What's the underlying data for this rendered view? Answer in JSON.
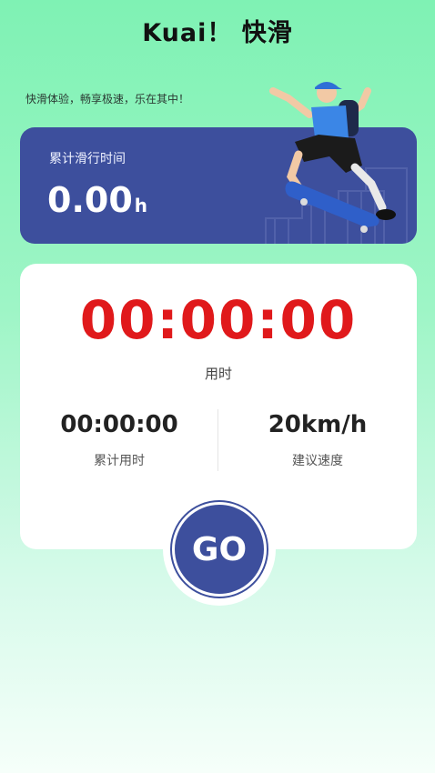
{
  "app": {
    "title": "Kuai！ 快滑",
    "tagline": "快滑体验，畅享极速，乐在其中！"
  },
  "summary": {
    "label": "累计滑行时间",
    "value": "0.00",
    "unit": "h"
  },
  "timer": {
    "value": "00:00:00",
    "label": "用时"
  },
  "stats": {
    "total_time": {
      "value": "00:00:00",
      "label": "累计用时"
    },
    "suggested_speed": {
      "value": "20km/h",
      "label": "建议速度"
    }
  },
  "go_button": {
    "label": "GO"
  },
  "colors": {
    "accent": "#3d4f9d",
    "timer_red": "#e0191b",
    "bg_green": "#7ff2b4"
  },
  "icons": {
    "illustration": "skateboarder-illustration"
  }
}
